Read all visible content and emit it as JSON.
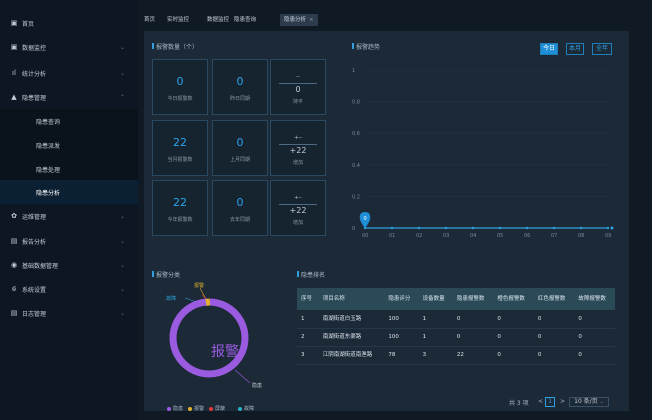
{
  "sidebar": {
    "items": [
      {
        "icon": "home-icon",
        "glyph": "▣",
        "label": "首页",
        "chevron": ""
      },
      {
        "icon": "monitor-icon",
        "glyph": "▣",
        "label": "数据监控",
        "chevron": "⌄"
      },
      {
        "icon": "bar-chart-icon",
        "glyph": "ıl",
        "label": "统计分析",
        "chevron": "⌄"
      },
      {
        "icon": "warning-icon",
        "glyph": "▲",
        "label": "隐患管理",
        "chevron": "⌃"
      }
    ],
    "subitems": [
      {
        "label": "隐患查询"
      },
      {
        "label": "隐患派发"
      },
      {
        "label": "隐患处理"
      },
      {
        "label": "隐患分析"
      }
    ],
    "items2": [
      {
        "icon": "gear-icon",
        "glyph": "✿",
        "label": "运维管理",
        "chevron": "⌄"
      },
      {
        "icon": "report-icon",
        "glyph": "▤",
        "label": "报告分析",
        "chevron": "⌄"
      },
      {
        "icon": "database-icon",
        "glyph": "◉",
        "label": "基础数据管理",
        "chevron": "⌄"
      },
      {
        "icon": "settings-icon",
        "glyph": "⟃",
        "label": "系统设置",
        "chevron": "⌄"
      },
      {
        "icon": "log-icon",
        "glyph": "▤",
        "label": "日志管理",
        "chevron": "⌄"
      }
    ]
  },
  "tabs": [
    {
      "label": "首页"
    },
    {
      "label": "实时监控"
    },
    {
      "label": "数据监控"
    },
    {
      "label": "隐患查询"
    },
    {
      "label": "隐患分析",
      "close": "×"
    }
  ],
  "stats": {
    "title": "报警数量（个）",
    "boxes": [
      {
        "num": "0",
        "label": "今日报警数"
      },
      {
        "num": "0",
        "label": "昨日同期"
      },
      {
        "top": "--",
        "num": "0",
        "label": "持平"
      },
      {
        "num": "22",
        "label": "当月报警数"
      },
      {
        "num": "0",
        "label": "上月同期"
      },
      {
        "top": "+--",
        "num": "+22",
        "label": "增加"
      },
      {
        "num": "22",
        "label": "今年报警数"
      },
      {
        "num": "0",
        "label": "去年同期"
      },
      {
        "top": "+--",
        "num": "+22",
        "label": "增加"
      }
    ]
  },
  "trend": {
    "title": "报警趋势",
    "buttons": [
      "今日",
      "本月",
      "全年"
    ]
  },
  "chart_data": {
    "type": "line",
    "title": "",
    "categories": [
      "00",
      "01",
      "02",
      "03",
      "04",
      "05",
      "06",
      "07",
      "08",
      "09"
    ],
    "ylim": [
      0,
      1
    ],
    "yticks": [
      "0",
      "0.2",
      "0.4",
      "0.6",
      "0.8",
      "1"
    ],
    "values": [
      0,
      0,
      0,
      0,
      0,
      0,
      0,
      0,
      0,
      0
    ],
    "marker": {
      "label": "0",
      "x": "00",
      "y": 0
    },
    "grid": true,
    "color": "#2ea0e0"
  },
  "classification": {
    "title": "报警分类",
    "center_text": "报警",
    "labels": [
      "报警",
      "故障",
      "隐患"
    ],
    "legend": [
      {
        "label": "隐患",
        "color": "#9a5be0"
      },
      {
        "label": "报警",
        "color": "#e0b030"
      },
      {
        "label": "屏蔽",
        "color": "#e03b3b"
      },
      {
        "label": "故障",
        "color": "#28b0c0"
      }
    ]
  },
  "ranking": {
    "title": "隐患排名",
    "headers": [
      "序号",
      "项目名称",
      "隐患评分",
      "设备数量",
      "隐患报警数",
      "橙色报警数",
      "红色报警数",
      "故障报警数"
    ],
    "rows": [
      [
        "1",
        "南湖街道白玉路",
        "100",
        "1",
        "0",
        "0",
        "0",
        "0"
      ],
      [
        "2",
        "南湖街道东渠路",
        "100",
        "1",
        "0",
        "0",
        "0",
        "0"
      ],
      [
        "3",
        "江阴南湖街道南渔路",
        "78",
        "3",
        "22",
        "0",
        "0",
        "0"
      ]
    ]
  },
  "pager": {
    "total": "共 3 项",
    "prev": "<",
    "page": "1",
    "next": ">",
    "size": "10 条/页"
  }
}
